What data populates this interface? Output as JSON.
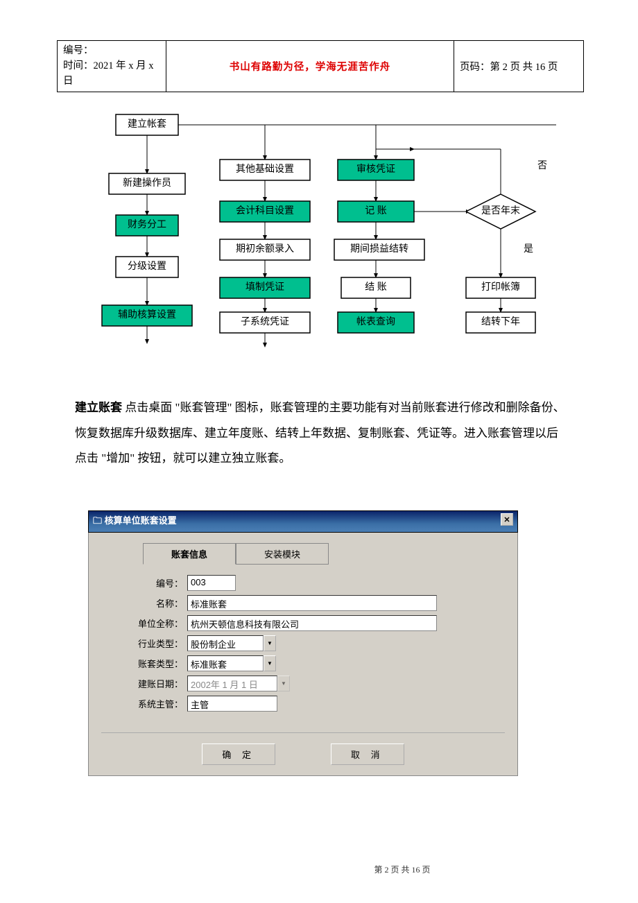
{
  "header": {
    "serial_label": "编号：",
    "date_label": "时间：2021 年 x 月 x 日",
    "motto": "书山有路勤为径，学海无涯苦作舟",
    "page_label": "页码：第 2 页 共 16 页"
  },
  "flow": {
    "n1": "建立帐套",
    "n2": "新建操作员",
    "n3": "财务分工",
    "n4": "分级设置",
    "n5": "辅助核算设置",
    "n6": "其他基础设置",
    "n7": "会计科目设置",
    "n8": "期初余额录入",
    "n9": "填制凭证",
    "n10": "子系统凭证",
    "n11": "审核凭证",
    "n12": "记   账",
    "n13": "期间损益结转",
    "n14": "结   账",
    "n15": "帐表查询",
    "d1": "是否年末",
    "n16": "打印帐簿",
    "n17": "结转下年",
    "lbl_no": "否",
    "lbl_yes": "是"
  },
  "para": {
    "lead": "建立账套",
    "rest": "   点击桌面 \"账套管理\" 图标，账套管理的主要功能有对当前账套进行修改和删除备份、恢复数据库升级数据库、建立年度账、结转上年数据、复制账套、凭证等。进入账套管理以后点击 \"增加\" 按钮，就可以建立独立账套。"
  },
  "dialog": {
    "title": "核算单位账套设置",
    "tab_active": "账套信息",
    "tab_other": "安装模块",
    "f1_lbl": "编号：",
    "f1_val": "003",
    "f2_lbl": "名称：",
    "f2_val": "标准账套",
    "f3_lbl": "单位全称：",
    "f3_val": "杭州天顿信息科技有限公司",
    "f4_lbl": "行业类型：",
    "f4_val": "股份制企业",
    "f5_lbl": "账套类型：",
    "f5_val": "标准账套",
    "f6_lbl": "建账日期：",
    "f6_val": "2002年 1 月 1 日",
    "f7_lbl": "系统主管：",
    "f7_val": "主管",
    "btn_ok": "确 定",
    "btn_cancel": "取 消"
  },
  "footer": "第 2 页 共 16 页"
}
